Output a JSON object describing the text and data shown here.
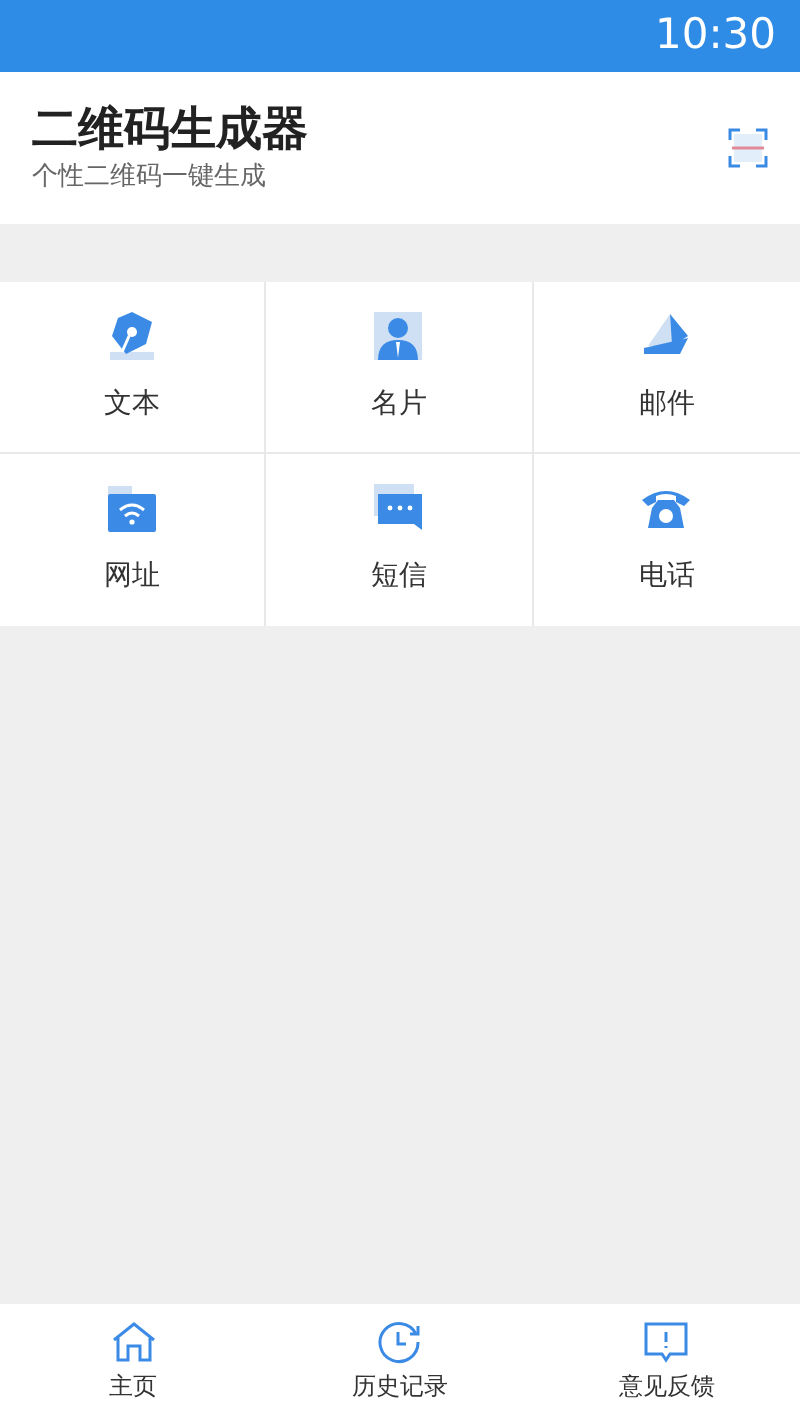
{
  "status_bar": {
    "time": "10:30"
  },
  "header": {
    "title": "二维码生成器",
    "subtitle": "个性二维码一键生成"
  },
  "grid": [
    {
      "kind": "text",
      "label": "文本"
    },
    {
      "kind": "card",
      "label": "名片"
    },
    {
      "kind": "mail",
      "label": "邮件"
    },
    {
      "kind": "url",
      "label": "网址"
    },
    {
      "kind": "sms",
      "label": "短信"
    },
    {
      "kind": "phone",
      "label": "电话"
    }
  ],
  "bottom_nav": [
    {
      "kind": "home",
      "label": "主页"
    },
    {
      "kind": "history",
      "label": "历史记录"
    },
    {
      "kind": "feedback",
      "label": "意见反馈"
    }
  ]
}
